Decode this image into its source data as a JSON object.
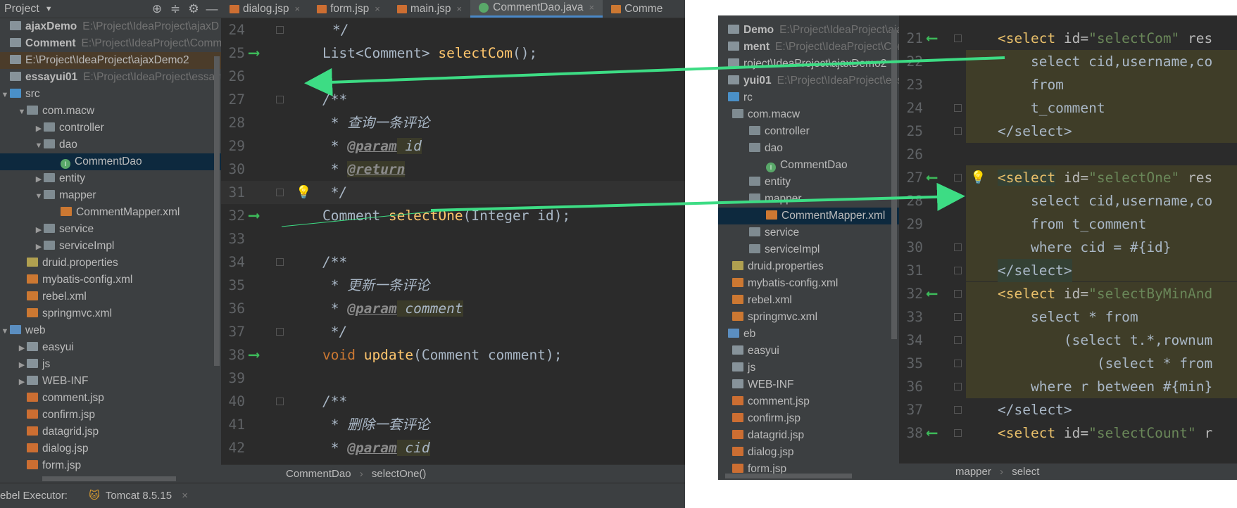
{
  "left": {
    "project_header": {
      "title": "Project"
    },
    "tree": [
      {
        "label": "ajaxDemo",
        "path": "E:\\Project\\IdeaProject\\ajaxD",
        "bold": true
      },
      {
        "label": "Comment",
        "path": "E:\\Project\\IdeaProject\\Comm",
        "bold": true
      },
      {
        "label": "E:\\Project\\IdeaProject\\ajaxDemo2",
        "path": ""
      },
      {
        "label": "essayui01",
        "path": "E:\\Project\\IdeaProject\\essayu",
        "bold": true
      },
      {
        "label": "src"
      },
      {
        "label": "com.macw"
      },
      {
        "label": "controller"
      },
      {
        "label": "dao"
      },
      {
        "label": "CommentDao"
      },
      {
        "label": "entity"
      },
      {
        "label": "mapper"
      },
      {
        "label": "CommentMapper.xml"
      },
      {
        "label": "service"
      },
      {
        "label": "serviceImpl"
      },
      {
        "label": "druid.properties"
      },
      {
        "label": "mybatis-config.xml"
      },
      {
        "label": "rebel.xml"
      },
      {
        "label": "springmvc.xml"
      },
      {
        "label": "web"
      },
      {
        "label": "easyui"
      },
      {
        "label": "js"
      },
      {
        "label": "WEB-INF"
      },
      {
        "label": "comment.jsp"
      },
      {
        "label": "confirm.jsp"
      },
      {
        "label": "datagrid.jsp"
      },
      {
        "label": "dialog.jsp"
      },
      {
        "label": "form.jsp"
      }
    ],
    "tabs": [
      "dialog.jsp",
      "form.jsp",
      "main.jsp",
      "CommentDao.java",
      "Comme"
    ],
    "lines": {
      "n": [
        "24",
        "25",
        "26",
        "27",
        "28",
        "29",
        "30",
        "31",
        "32",
        "33",
        "34",
        "35",
        "36",
        "37",
        "38",
        "39",
        "40",
        "41",
        "42"
      ],
      "l24": "*/",
      "l25a": "List<Comment> ",
      "l25b": "selectCom",
      "l25c": "();",
      "l27": "/**",
      "l28": " * 查询一条评论",
      "l29a": " * ",
      "l29b": "@param",
      "l29c": " id",
      "l30a": " * ",
      "l30b": "@return",
      "l31": " */",
      "l32a": "Comment ",
      "l32b": "selectOne",
      "l32c": "(Integer id);",
      "l34": "/**",
      "l35": " * 更新一条评论",
      "l36a": " * ",
      "l36b": "@param",
      "l36c": " comment",
      "l37": " */",
      "l38a": "void ",
      "l38b": "update",
      "l38c": "(Comment comment);",
      "l40": "/**",
      "l41": " * 删除一套评论",
      "l42a": " * ",
      "l42b": "@param",
      "l42c": " cid"
    },
    "breadcrumb": [
      "CommentDao",
      "selectOne()"
    ],
    "status": {
      "executor": "ebel Executor:",
      "tomcat": "Tomcat 8.5.15"
    }
  },
  "right": {
    "tree": [
      {
        "label": "Demo",
        "path": "E:\\Project\\IdeaProject\\ajaxD",
        "bold": true
      },
      {
        "label": "ment",
        "path": "E:\\Project\\IdeaProject\\Comm",
        "bold": true
      },
      {
        "label": "roject\\IdeaProject\\ajaxDemo2",
        "path": ""
      },
      {
        "label": "yui01",
        "path": "E:\\Project\\IdeaProject\\essayu",
        "bold": true
      },
      {
        "label": "rc"
      },
      {
        "label": "com.macw"
      },
      {
        "label": "controller"
      },
      {
        "label": "dao"
      },
      {
        "label": "CommentDao"
      },
      {
        "label": "entity"
      },
      {
        "label": "mapper"
      },
      {
        "label": "CommentMapper.xml"
      },
      {
        "label": "service"
      },
      {
        "label": "serviceImpl"
      },
      {
        "label": "druid.properties"
      },
      {
        "label": "mybatis-config.xml"
      },
      {
        "label": "rebel.xml"
      },
      {
        "label": "springmvc.xml"
      },
      {
        "label": "eb"
      },
      {
        "label": "easyui"
      },
      {
        "label": "js"
      },
      {
        "label": "WEB-INF"
      },
      {
        "label": "comment.jsp"
      },
      {
        "label": "confirm.jsp"
      },
      {
        "label": "datagrid.jsp"
      },
      {
        "label": "dialog.jsp"
      },
      {
        "label": "form.jsp"
      }
    ],
    "lines": {
      "n": [
        "21",
        "22",
        "23",
        "24",
        "25",
        "26",
        "27",
        "28",
        "29",
        "30",
        "31",
        "32",
        "33",
        "34",
        "35",
        "36",
        "37",
        "38"
      ],
      "l21a": "<select",
      "l21b": " id=",
      "l21c": "\"selectCom\"",
      "l21d": " res",
      "l22": "    select cid,username,co",
      "l23": "    from",
      "l24": "    t_comment",
      "l25": "</select>",
      "l27a": "<select",
      "l27b": " id=",
      "l27c": "\"selectOne\"",
      "l27d": " res",
      "l28": "    select cid,username,co",
      "l29": "    from t_comment",
      "l30": "    where cid = #{id}",
      "l31": "</select>",
      "l32a": "<select",
      "l32b": " id=",
      "l32c": "\"selectByMinAnd",
      "l33": "    select * from",
      "l34": "        (select t.*,rownum",
      "l35": "            (select * from",
      "l36": "    where r between #{min}",
      "l37": "</select>",
      "l38a": "<select",
      "l38b": " id=",
      "l38c": "\"selectCount\"",
      "l38d": " r"
    },
    "breadcrumb": [
      "mapper",
      "select"
    ]
  },
  "colors": {
    "arrow": "#3ddc84",
    "accent": "#4a88c7"
  }
}
